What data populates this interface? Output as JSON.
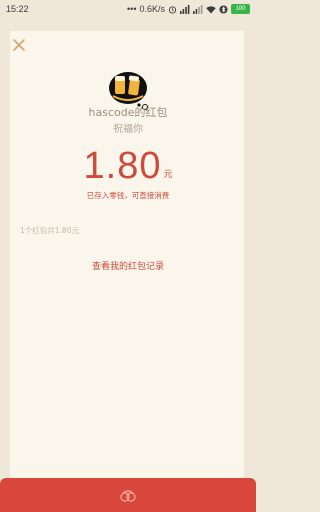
{
  "status_bar": {
    "time": "15:22",
    "network_speed": "0.6K/s",
    "battery": "100"
  },
  "colors": {
    "accent_red": "#cf4a3a",
    "card_bg": "#faf6ec",
    "page_bg": "#efe7d8",
    "footer_red": "#d9473c"
  },
  "icons": {
    "close": "close-icon",
    "avatar": "avatar-beer-icon",
    "footer": "footer-logo-icon"
  },
  "packet": {
    "sender": "hascode的红包",
    "greeting": "祝福你",
    "amount": "1.80",
    "unit": "元",
    "deposit_note": "已存入零钱，可直接消费",
    "summary": "1个红包共1.80元",
    "record_link": "查看我的红包记录"
  }
}
